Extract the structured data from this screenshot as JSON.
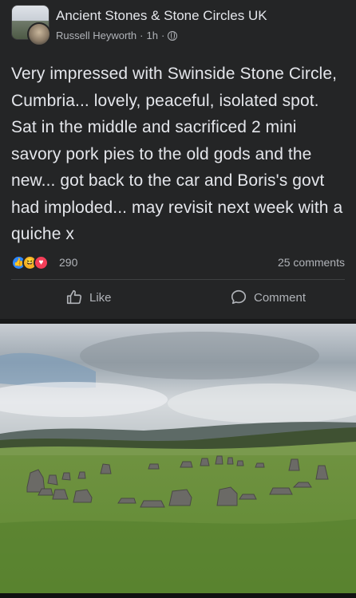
{
  "post": {
    "group_name": "Ancient Stones & Stone Circles UK",
    "author": "Russell Heyworth",
    "time": "1h",
    "separator": "·",
    "text": "Very impressed with Swinside Stone Circle, Cumbria... lovely, peaceful, isolated spot. Sat in the middle and sacrificed 2 mini savory pork pies to the old gods and the new... got back to the car and Boris's govt had imploded... may revisit next week with a quiche x",
    "reactions": {
      "types": [
        "like-icon",
        "haha-icon",
        "love-icon"
      ],
      "count": "290"
    },
    "comments_count": "25 comments",
    "actions": {
      "like_label": "Like",
      "comment_label": "Comment"
    },
    "photo": {
      "icon": "stone-circle-photo"
    }
  },
  "colors": {
    "background": "#18191a",
    "card": "#242526",
    "text_primary": "#e4e6eb",
    "text_secondary": "#b0b3b8",
    "like_blue": "#2d88ff",
    "haha_yellow": "#f7b125",
    "love_red": "#f33e58"
  }
}
